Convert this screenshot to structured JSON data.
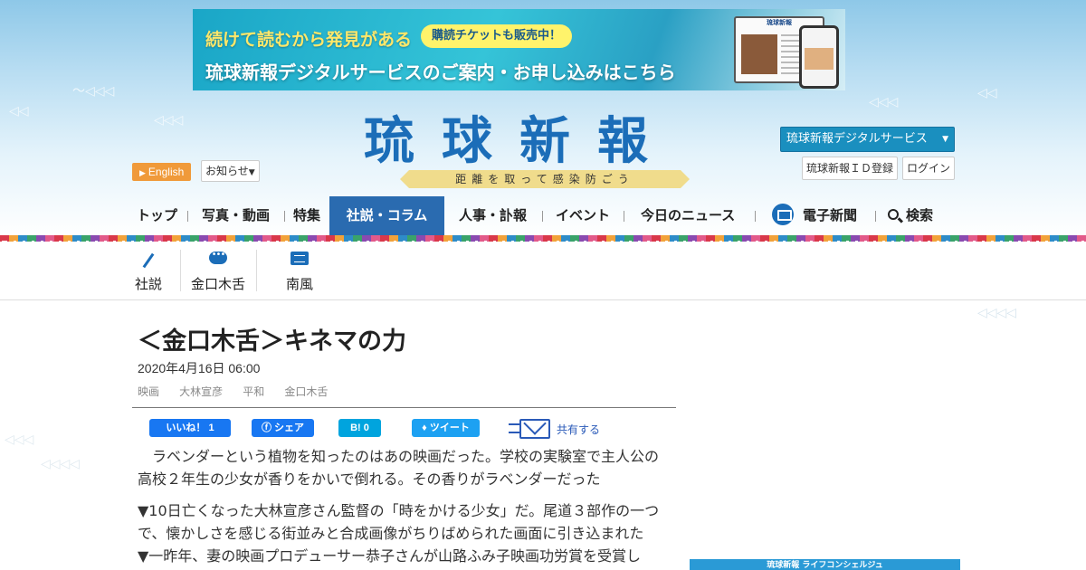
{
  "banner": {
    "line1": "続けて読むから発見がある",
    "pill": "購読チケットも販売中！",
    "line2": "琉球新報デジタルサービスのご案内・お申し込みはこちら",
    "device_title": "琉球新報"
  },
  "header": {
    "logo": "琉球新報",
    "tagline": "距離を取って感染防ごう",
    "english_label": "English",
    "news_label": "お知らせ",
    "digital_service_label": "琉球新報デジタルサービス",
    "id_register_label": "琉球新報ＩＤ登録",
    "login_label": "ログイン"
  },
  "nav": {
    "items": [
      {
        "label": "トップ"
      },
      {
        "label": "写真・動画"
      },
      {
        "label": "特集"
      },
      {
        "label": "社説・コラム",
        "active": true
      },
      {
        "label": "人事・訃報"
      },
      {
        "label": "イベント"
      },
      {
        "label": "今日のニュース"
      },
      {
        "label": "電子新聞"
      },
      {
        "label": "検索"
      }
    ]
  },
  "subnav": {
    "items": [
      {
        "label": "社説",
        "icon": "pen-icon"
      },
      {
        "label": "金口木舌",
        "icon": "speech-bubble-icon"
      },
      {
        "label": "南風",
        "icon": "notepad-icon"
      }
    ]
  },
  "article": {
    "title": "＜金口木舌＞キネマの力",
    "date": "2020年4月16日 06:00",
    "tags": [
      "映画",
      "大林宣彦",
      "平和",
      "金口木舌"
    ],
    "paragraphs": [
      "　ラベンダーという植物を知ったのはあの映画だった。学校の実験室で主人公の高校２年生の少女が香りをかいで倒れる。その香りがラベンダーだった",
      "▼10日亡くなった大林宣彦さん監督の「時をかける少女」だ。尾道３部作の一つで、懐かしさを感じる街並みと合成画像がちりばめられた画面に引き込まれた",
      "▼一昨年、妻の映画プロデューサー恭子さんが山路ふみ子映画功労賞を受賞し"
    ]
  },
  "share": {
    "like_label": "いいね！ 1",
    "fb_share_label": "シェア",
    "hatena_label": "B! 0",
    "tweet_label": "ツイート",
    "mail_label": "共有する"
  },
  "sidebar": {
    "ad_label": "琉球新報 ライフコンシェルジュ"
  },
  "colors": {
    "brand_blue": "#1b6db8",
    "nav_active": "#2a6bb0",
    "english_orange": "#f09a3a",
    "facebook": "#1877f2",
    "twitter": "#1da1f2",
    "hatena": "#00a4de"
  }
}
